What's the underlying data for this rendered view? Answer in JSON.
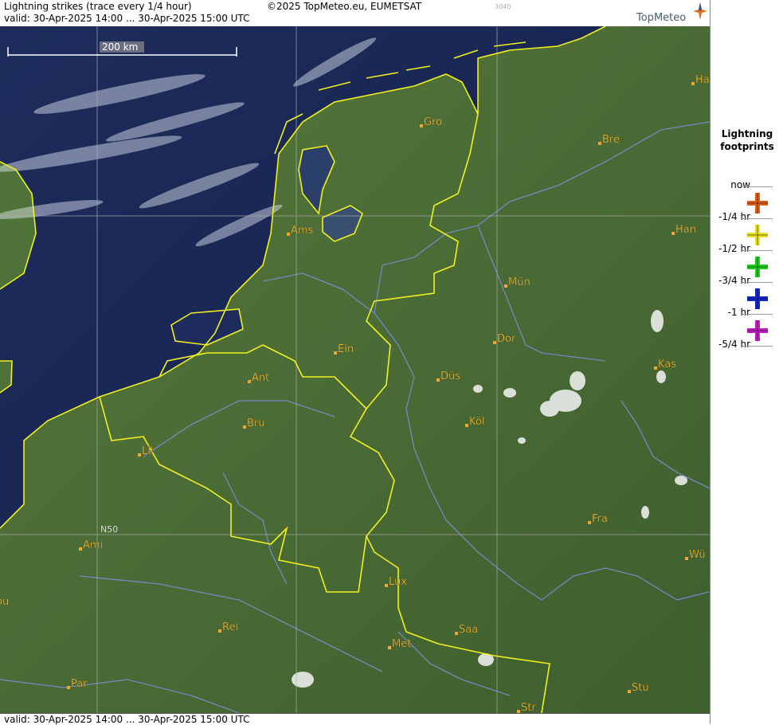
{
  "header": {
    "title": "Lightning strikes (trace every 1/4 hour)",
    "copyright": "©2025 TopMeteo.eu, EUMETSAT",
    "valid": "valid:  30-Apr-2025 14:00 ... 30-Apr-2025 15:00 UTC",
    "code": "3040",
    "brand": "TopMeteo"
  },
  "scale": {
    "label": "200 km"
  },
  "gridlabel": "N50",
  "cities": [
    {
      "name": "Gro"
    },
    {
      "name": "Bre"
    },
    {
      "name": "Ha"
    },
    {
      "name": "Ams"
    },
    {
      "name": "Han"
    },
    {
      "name": "Mün"
    },
    {
      "name": "Ein"
    },
    {
      "name": "Dor"
    },
    {
      "name": "Ant"
    },
    {
      "name": "Düs"
    },
    {
      "name": "Kas"
    },
    {
      "name": "Bru"
    },
    {
      "name": "Köl"
    },
    {
      "name": "Lil"
    },
    {
      "name": "Fra"
    },
    {
      "name": "Ami"
    },
    {
      "name": "Wü"
    },
    {
      "name": "Lux"
    },
    {
      "name": "ou"
    },
    {
      "name": "Rei"
    },
    {
      "name": "Saa"
    },
    {
      "name": "Met"
    },
    {
      "name": "Par"
    },
    {
      "name": "Stu"
    },
    {
      "name": "Str"
    }
  ],
  "footer": {
    "valid": "valid:  30-Apr-2025 14:00 ... 30-Apr-2025 15:00 UTC"
  },
  "legend": {
    "title_line1": "Lightning",
    "title_line2": "footprints",
    "entries": [
      {
        "label": "now",
        "color": "#e0601a"
      },
      {
        "label": "-1/4 hr",
        "color": "#e8e020"
      },
      {
        "label": "-1/2 hr",
        "color": "#20d020"
      },
      {
        "label": "-3/4 hr",
        "color": "#1428c8"
      },
      {
        "label": "-1 hr",
        "color": "#c020c0"
      },
      {
        "label": "-5/4 hr",
        "color": ""
      }
    ]
  },
  "colors": {
    "sea": "#1a2a55",
    "land": "#4a6b35",
    "border": "#f0f020",
    "city": "#f2c33a"
  }
}
